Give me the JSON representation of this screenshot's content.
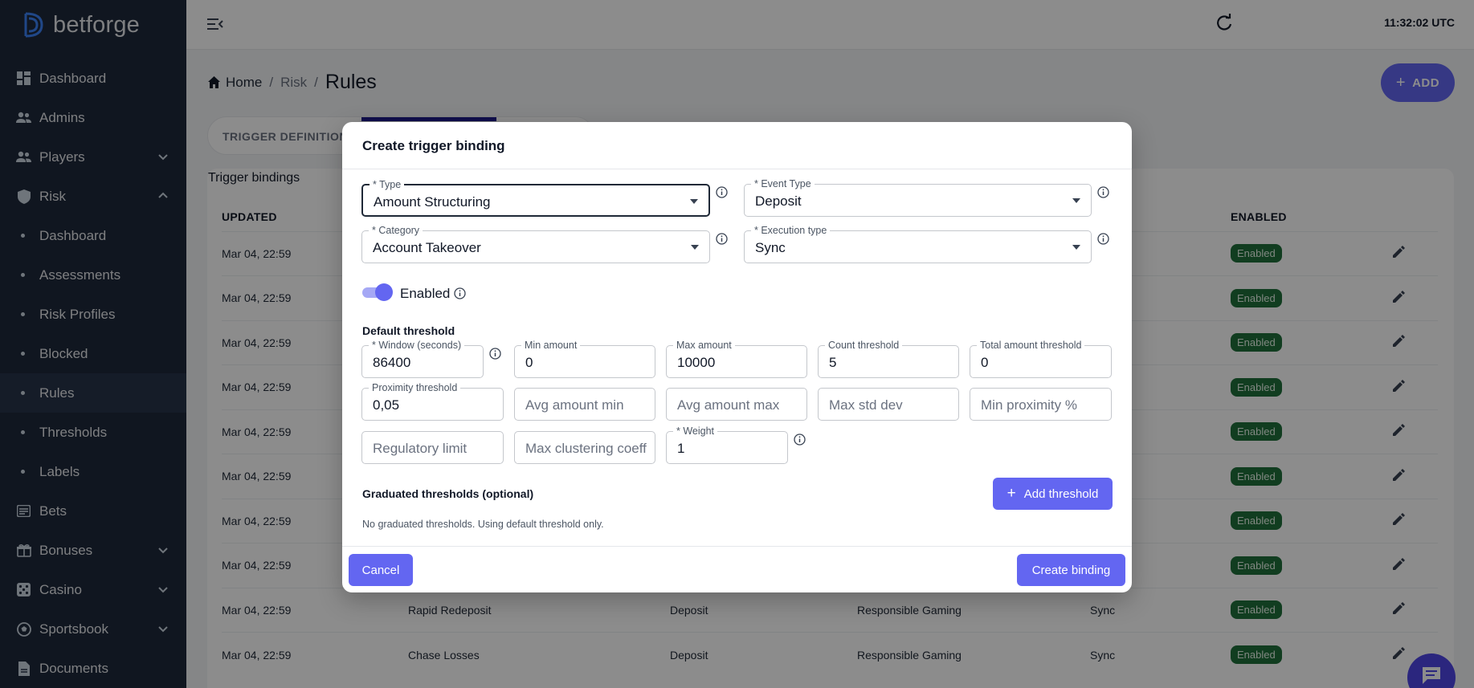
{
  "brand": {
    "name": "betforge"
  },
  "clock": "11:32:02 UTC",
  "sidebar": {
    "items": [
      {
        "label": "Dashboard",
        "icon": "dashboard-icon"
      },
      {
        "label": "Admins",
        "icon": "admins-icon"
      },
      {
        "label": "Players",
        "icon": "players-icon",
        "expandable": true
      },
      {
        "label": "Risk",
        "icon": "shield-icon",
        "expanded": true
      },
      {
        "label": "Bets",
        "icon": "receipt-icon"
      },
      {
        "label": "Bonuses",
        "icon": "gift-icon",
        "expandable": true
      },
      {
        "label": "Casino",
        "icon": "dice-icon",
        "expandable": true
      },
      {
        "label": "Sportsbook",
        "icon": "ball-icon",
        "expandable": true
      },
      {
        "label": "Documents",
        "icon": "document-icon"
      }
    ],
    "risk_sub": [
      "Dashboard",
      "Assessments",
      "Risk Profiles",
      "Blocked",
      "Rules",
      "Thresholds",
      "Labels"
    ],
    "active_sub": "Rules"
  },
  "breadcrumb": {
    "home": "Home",
    "section": "Risk",
    "current": "Rules",
    "sep": "/"
  },
  "add_button": {
    "label": "ADD"
  },
  "tabs": {
    "first": "TRIGGER DEFINITIONS"
  },
  "table": {
    "title": "Trigger bindings",
    "headers": {
      "updated": "UPDATED",
      "enabled": "ENABLED"
    },
    "rows": [
      {
        "updated": "Mar 04, 22:59",
        "type": "",
        "event": "",
        "category": "",
        "exec": "",
        "status": "Enabled"
      },
      {
        "updated": "Mar 04, 22:59",
        "type": "",
        "event": "",
        "category": "",
        "exec": "",
        "status": "Enabled"
      },
      {
        "updated": "Mar 04, 22:59",
        "type": "",
        "event": "",
        "category": "",
        "exec": "",
        "status": "Enabled"
      },
      {
        "updated": "Mar 04, 22:59",
        "type": "",
        "event": "",
        "category": "",
        "exec": "",
        "status": "Enabled"
      },
      {
        "updated": "Mar 04, 22:59",
        "type": "",
        "event": "",
        "category": "",
        "exec": "",
        "status": "Enabled"
      },
      {
        "updated": "Mar 04, 22:59",
        "type": "",
        "event": "",
        "category": "",
        "exec": "",
        "status": "Enabled"
      },
      {
        "updated": "Mar 04, 22:59",
        "type": "",
        "event": "",
        "category": "",
        "exec": "",
        "status": "Enabled"
      },
      {
        "updated": "Mar 04, 22:59",
        "type": "",
        "event": "",
        "category": "",
        "exec": "",
        "status": "Enabled"
      },
      {
        "updated": "Mar 04, 22:59",
        "type": "Rapid Redeposit",
        "event": "Deposit",
        "category": "Responsible Gaming",
        "exec": "Sync",
        "status": "Enabled"
      },
      {
        "updated": "Mar 04, 22:59",
        "type": "Chase Losses",
        "event": "Deposit",
        "category": "Responsible Gaming",
        "exec": "Sync",
        "status": "Enabled"
      }
    ]
  },
  "modal": {
    "title": "Create trigger binding",
    "type": {
      "label": "* Type",
      "value": "Amount Structuring"
    },
    "event_type": {
      "label": "* Event Type",
      "value": "Deposit"
    },
    "category": {
      "label": "* Category",
      "value": "Account Takeover"
    },
    "execution_type": {
      "label": "* Execution type",
      "value": "Sync"
    },
    "enabled_label": "Enabled",
    "enabled": true,
    "default_threshold_title": "Default threshold",
    "window": {
      "label": "* Window (seconds)",
      "value": "86400"
    },
    "min_amount": {
      "label": "Min amount",
      "value": "0"
    },
    "max_amount": {
      "label": "Max amount",
      "value": "10000"
    },
    "count_threshold": {
      "label": "Count threshold",
      "value": "5"
    },
    "total_amount_threshold": {
      "label": "Total amount threshold",
      "value": "0"
    },
    "proximity_threshold": {
      "label": "Proximity threshold",
      "value": "0,05"
    },
    "avg_amount_min": {
      "placeholder": "Avg amount min"
    },
    "avg_amount_max": {
      "placeholder": "Avg amount max"
    },
    "max_std_dev": {
      "placeholder": "Max std dev"
    },
    "min_proximity": {
      "placeholder": "Min proximity %"
    },
    "regulatory_limit": {
      "placeholder": "Regulatory limit"
    },
    "max_clustering": {
      "placeholder": "Max clustering coeff"
    },
    "weight": {
      "label": "* Weight",
      "value": "1"
    },
    "graduated_title": "Graduated thresholds (optional)",
    "add_threshold": "Add threshold",
    "graduated_note": "No graduated thresholds. Using default threshold only.",
    "cancel": "Cancel",
    "create": "Create binding"
  },
  "colors": {
    "accent": "#6366f1",
    "sidebar": "#1e293b",
    "badge": "#1f6f3b"
  }
}
